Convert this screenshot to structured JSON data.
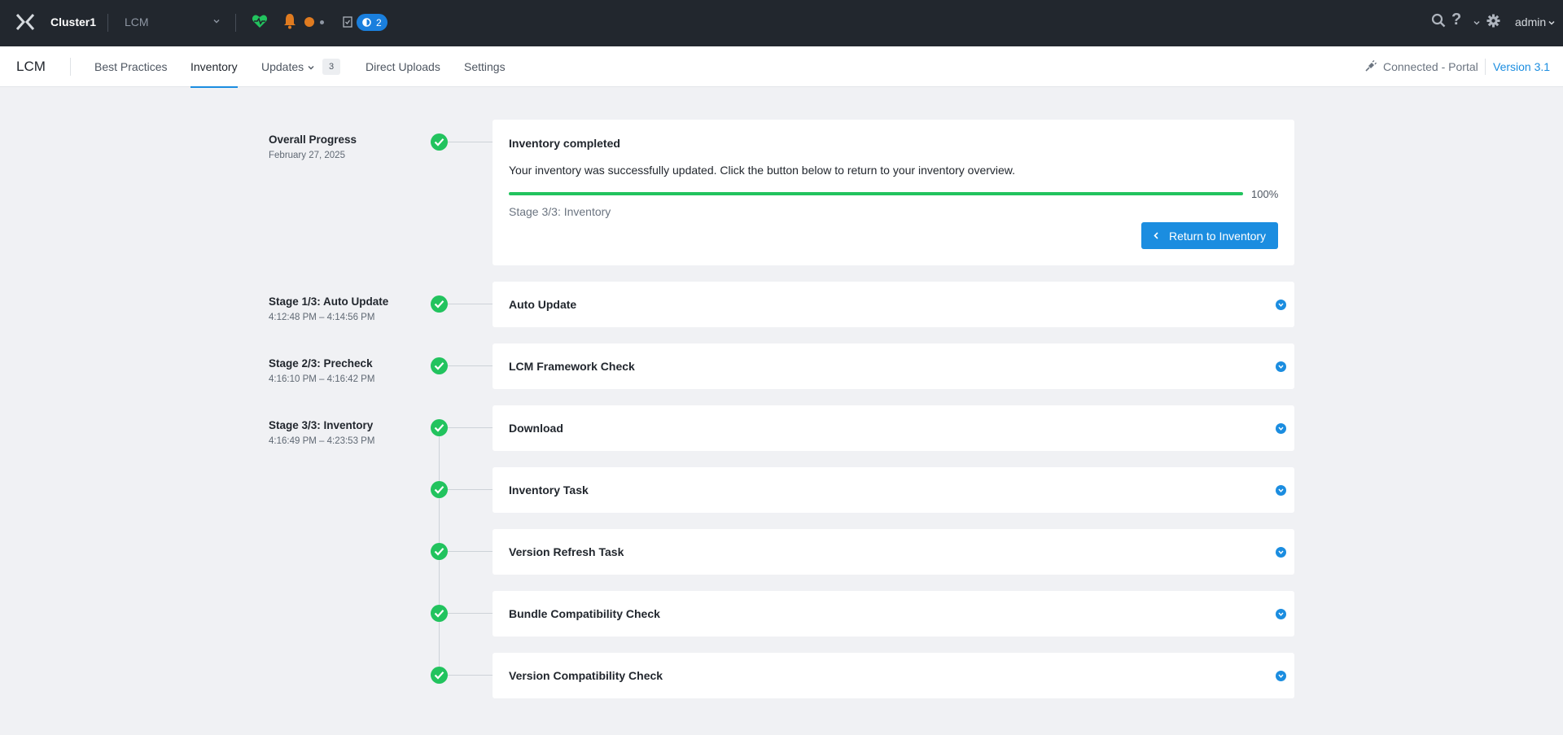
{
  "topbar": {
    "cluster_name": "Cluster1",
    "app_selector": "LCM",
    "task_count": "2",
    "user": "admin"
  },
  "subnav": {
    "title": "LCM",
    "tabs": [
      {
        "label": "Best Practices"
      },
      {
        "label": "Inventory",
        "active": true
      },
      {
        "label": "Updates",
        "badge": "3"
      },
      {
        "label": "Direct Uploads"
      },
      {
        "label": "Settings"
      }
    ],
    "connection": "Connected - Portal",
    "version": "Version 3.1"
  },
  "overall": {
    "label": "Overall Progress",
    "date": "February 27, 2025",
    "card_title": "Inventory completed",
    "message": "Your inventory was successfully updated. Click the button below to return to your inventory overview.",
    "progress": 100,
    "progress_label": "100%",
    "current_stage": "Stage 3/3: Inventory",
    "button_label": "Return to Inventory"
  },
  "stages": [
    {
      "title": "Stage 1/3: Auto Update",
      "time": "4:12:48 PM – 4:14:56 PM"
    },
    {
      "title": "Stage 2/3: Precheck",
      "time": "4:16:10 PM – 4:16:42 PM"
    },
    {
      "title": "Stage 3/3: Inventory",
      "time": "4:16:49 PM – 4:23:53 PM"
    }
  ],
  "steps": [
    {
      "label": "Auto Update",
      "status": "completed"
    },
    {
      "label": "LCM Framework Check",
      "status": "completed"
    },
    {
      "label": "Download",
      "status": "completed"
    },
    {
      "label": "Inventory Task",
      "status": "completed"
    },
    {
      "label": "Version Refresh Task",
      "status": "completed"
    },
    {
      "label": "Bundle Compatibility Check",
      "status": "completed"
    },
    {
      "label": "Version Compatibility Check",
      "status": "completed"
    }
  ],
  "colors": {
    "topbar_bg": "#22272e",
    "accent": "#1b8de0",
    "success": "#22c35e",
    "alert": "#e07b20"
  },
  "icons": [
    "product-logo-icon",
    "chevron-down-icon",
    "health-heart-icon",
    "bell-icon",
    "tasks-clipboard-icon",
    "spinner-icon",
    "search-icon",
    "help-icon",
    "gear-icon",
    "plug-icon",
    "check-circle-icon",
    "chevron-left-icon"
  ]
}
